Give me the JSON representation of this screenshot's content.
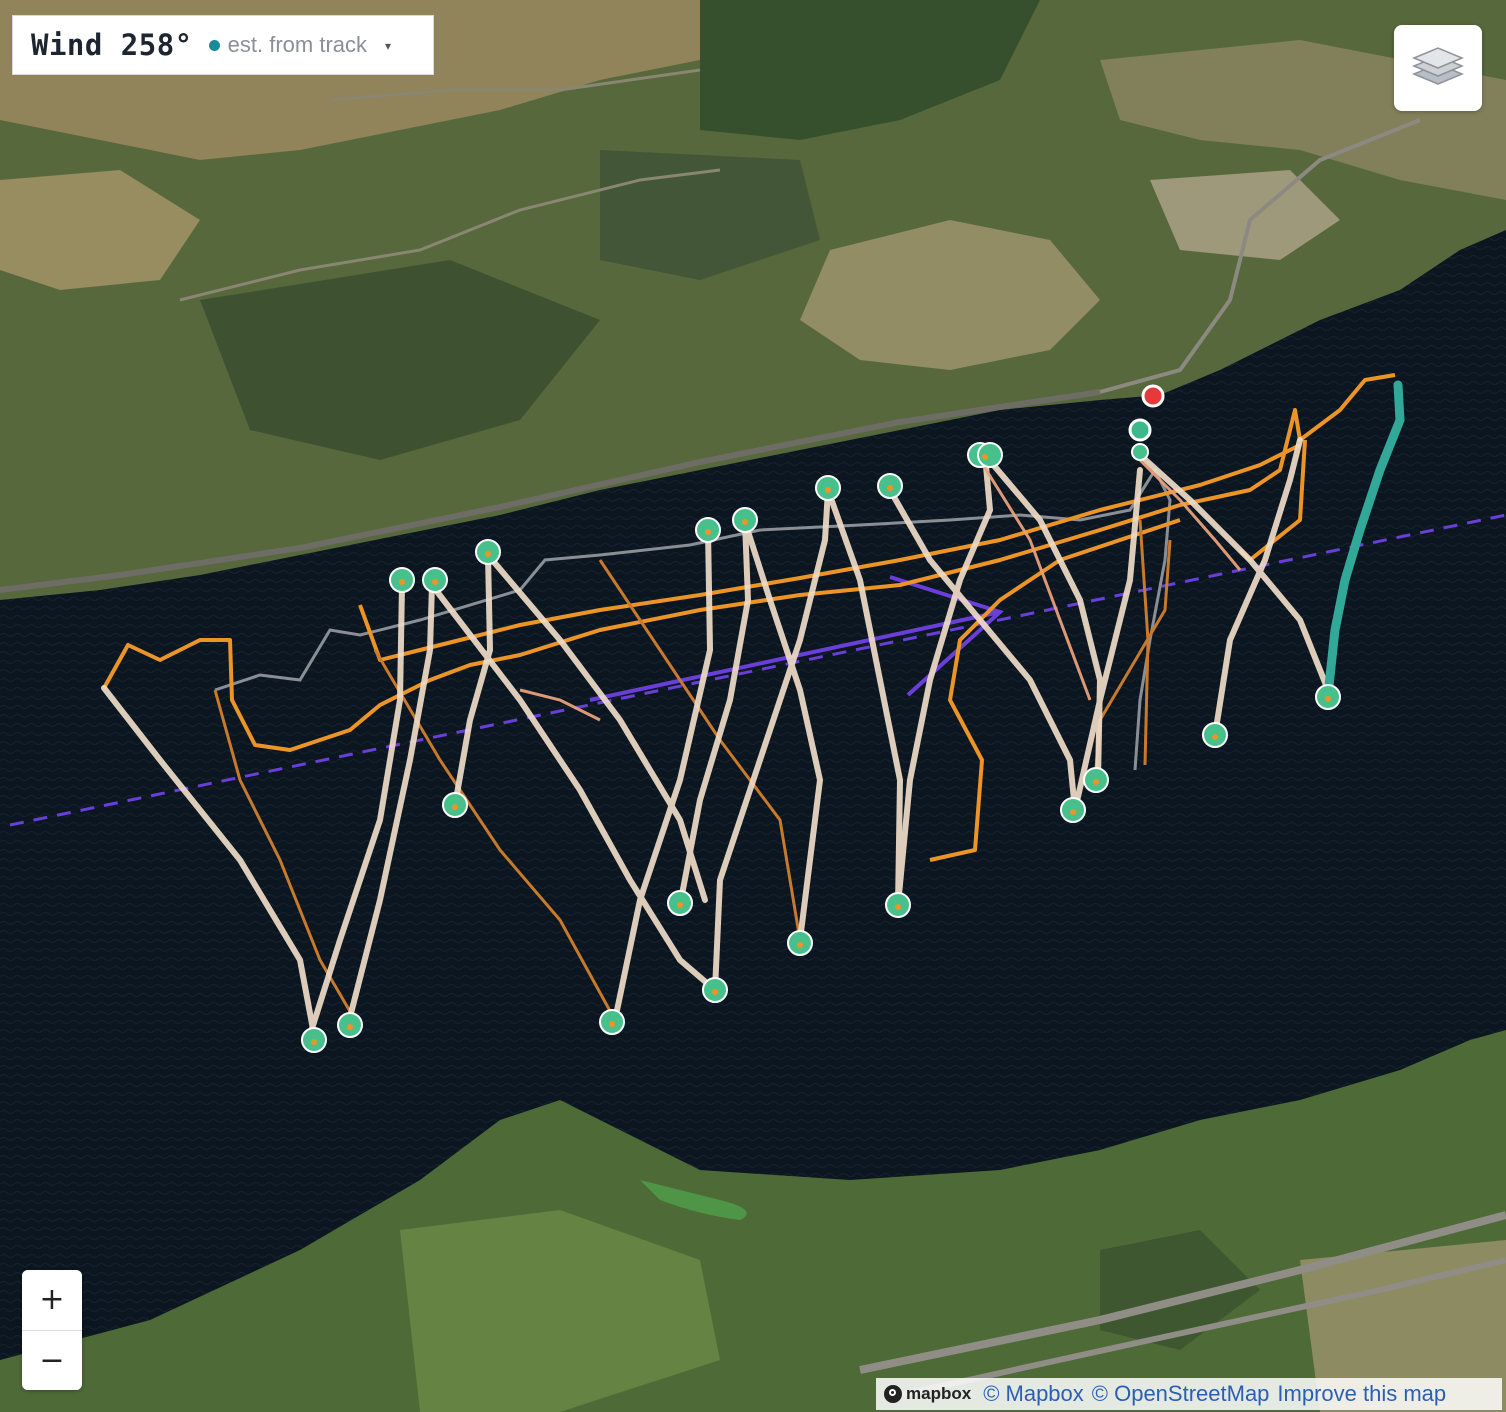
{
  "wind": {
    "label": "Wind 258°",
    "source": "est. from track",
    "caret": "▾",
    "dot_color": "#1a8a9a"
  },
  "layers_button": {
    "icon": "layers-icon"
  },
  "zoom": {
    "in_label": "+",
    "out_label": "−"
  },
  "attribution": {
    "logo": "mapbox",
    "links": [
      "© Mapbox",
      "© OpenStreetMap",
      "Improve this map"
    ]
  },
  "map": {
    "basemap": "satellite",
    "colors": {
      "water": "#0b1620",
      "land": "#56683c",
      "track_light": "#f0d8c2",
      "track_orange": "#ec9526",
      "track_peach": "#e9a07a",
      "track_gray": "#8a8f96",
      "wind_line": "#6a3fd8",
      "track_teal": "#32a898",
      "start_marker": "#3db88a",
      "end_marker": "#e5393b",
      "turn_marker": "#48c08c"
    }
  }
}
